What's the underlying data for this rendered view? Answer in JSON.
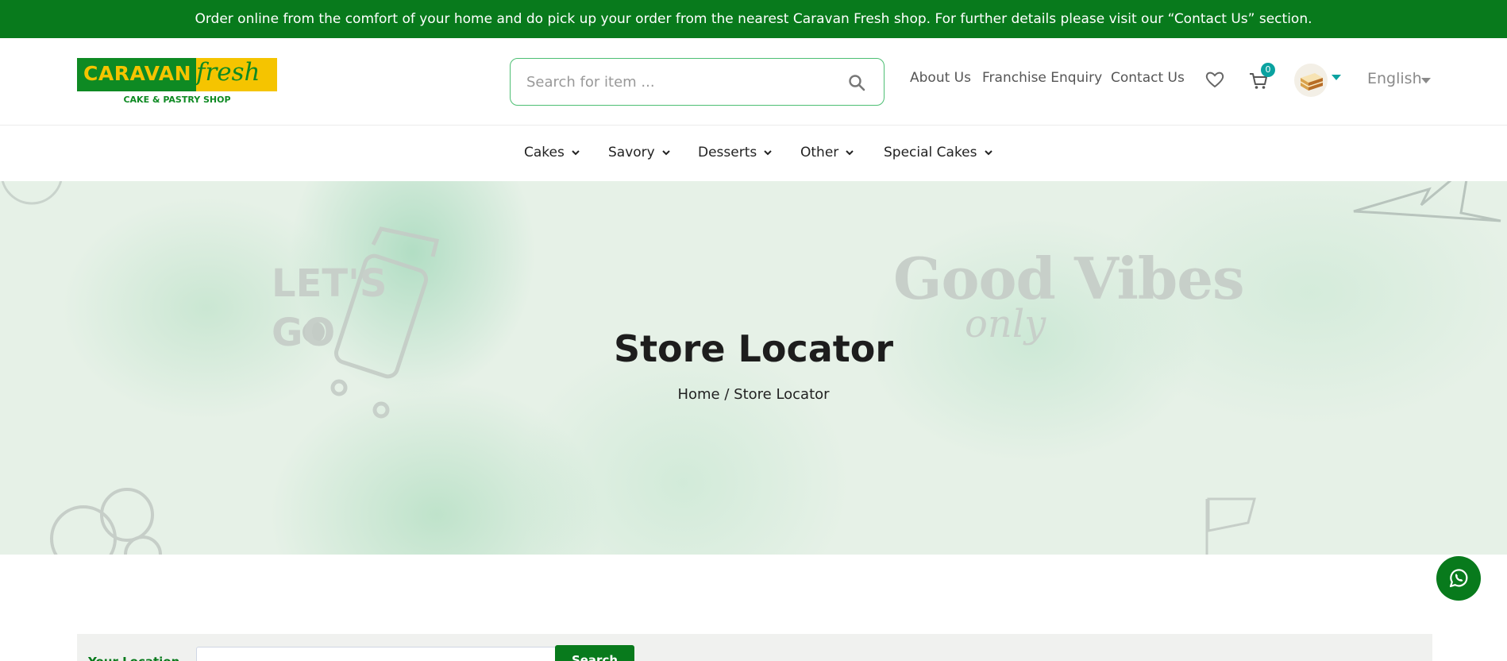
{
  "announcement": "Order online from the comfort of your home and do pick up your order from the nearest Caravan Fresh shop. For further details please visit our “Contact Us” section.",
  "logo": {
    "word1": "CARAVAN",
    "word2": "fresh",
    "tagline": "CAKE & PASTRY SHOP"
  },
  "search": {
    "placeholder": "Search for item ..."
  },
  "header_links": {
    "about": "About Us",
    "franchise": "Franchise Enquiry",
    "contact": "Contact Us"
  },
  "cart": {
    "count": "0"
  },
  "language": {
    "selected": "English"
  },
  "nav": {
    "items": [
      "Cakes",
      "Savory",
      "Desserts",
      "Other",
      "Special Cakes"
    ]
  },
  "hero": {
    "title": "Store Locator",
    "breadcrumb": {
      "home": "Home",
      "separator": "/",
      "current": "Store Locator"
    }
  },
  "locator": {
    "label": "Your Location",
    "button": "Search"
  },
  "colors": {
    "brand_green": "#087a1c",
    "accent_teal": "#0aa2a0",
    "logo_yellow": "#f5c400"
  }
}
